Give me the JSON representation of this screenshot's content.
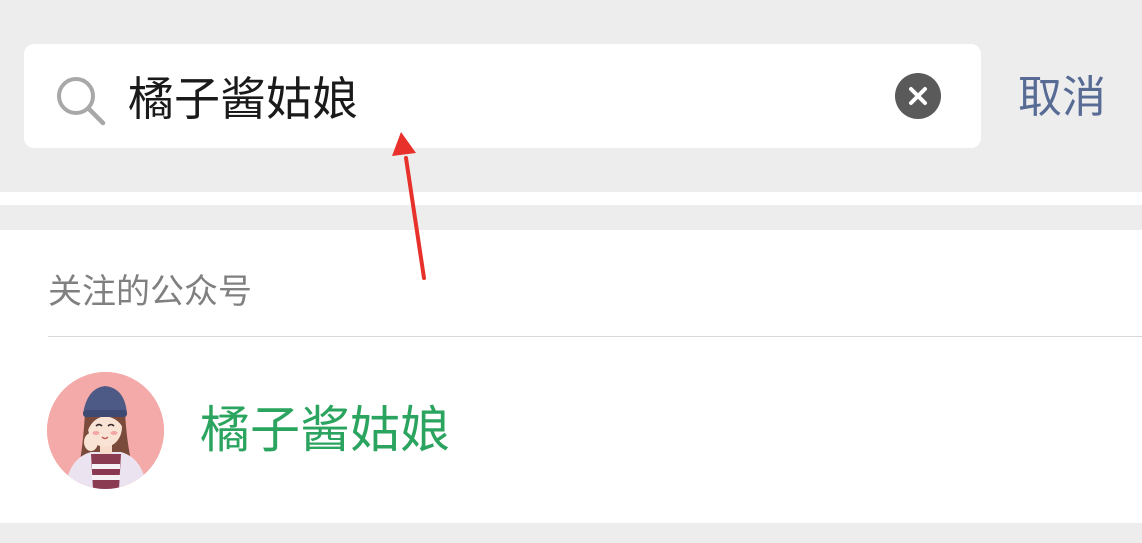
{
  "search": {
    "query": "橘子酱姑娘",
    "cancel_label": "取消",
    "icons": {
      "search": "search-icon",
      "clear": "clear-icon"
    }
  },
  "results": {
    "section_title": "关注的公众号",
    "items": [
      {
        "name": "橘子酱姑娘",
        "avatar": "girl-avatar"
      }
    ]
  },
  "colors": {
    "background": "#ededed",
    "link": "#576b95",
    "highlight": "#2aa45f",
    "annotation": "#e8312a"
  }
}
